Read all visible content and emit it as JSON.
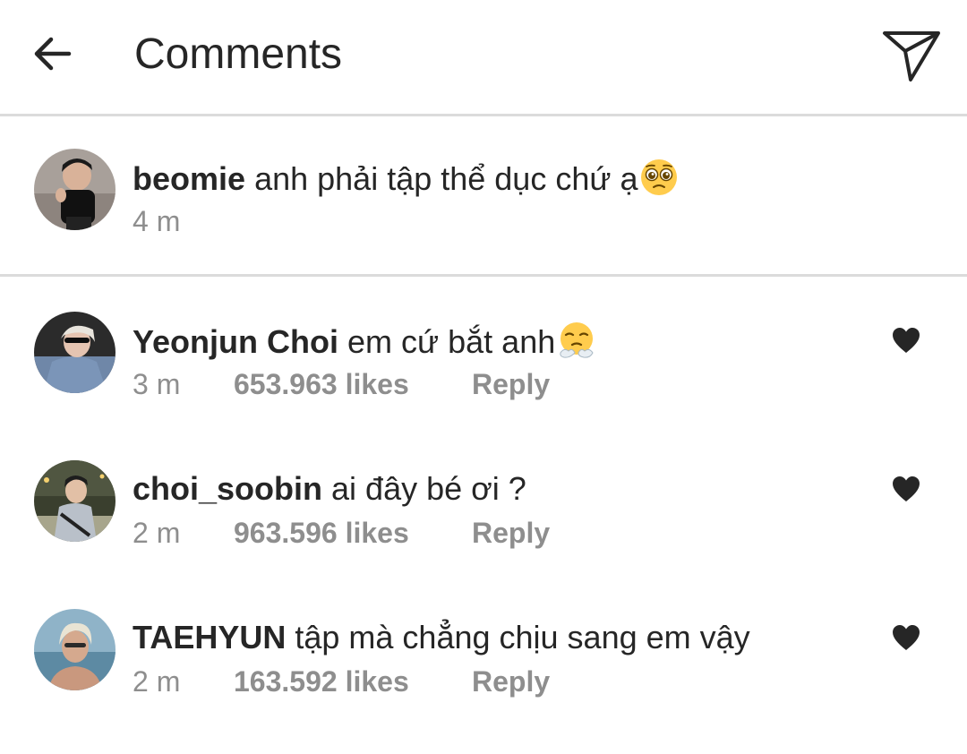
{
  "header": {
    "title": "Comments",
    "back_icon": "arrow-left-icon",
    "share_icon": "paper-plane-icon"
  },
  "caption": {
    "username": "beomie",
    "text": "anh phải tập thể dục chứ ạ",
    "emoji": "pleading-face-emoji",
    "time": "4 m"
  },
  "comments": [
    {
      "username": "Yeonjun Choi",
      "text": "em cứ bắt anh",
      "emoji": "face-with-steam-emoji",
      "time": "3 m",
      "likes": "653.963 likes",
      "reply": "Reply"
    },
    {
      "username": "choi_soobin",
      "text": "ai đây bé ơi ?",
      "time": "2 m",
      "likes": "963.596 likes",
      "reply": "Reply"
    },
    {
      "username": "TAEHYUN",
      "text": "tập mà chẳng chịu sang em vậy",
      "time": "2 m",
      "likes": "163.592 likes",
      "reply": "Reply"
    }
  ],
  "colors": {
    "text": "#262626",
    "secondary": "#8e8e8e",
    "divider": "#dbdbdb"
  }
}
